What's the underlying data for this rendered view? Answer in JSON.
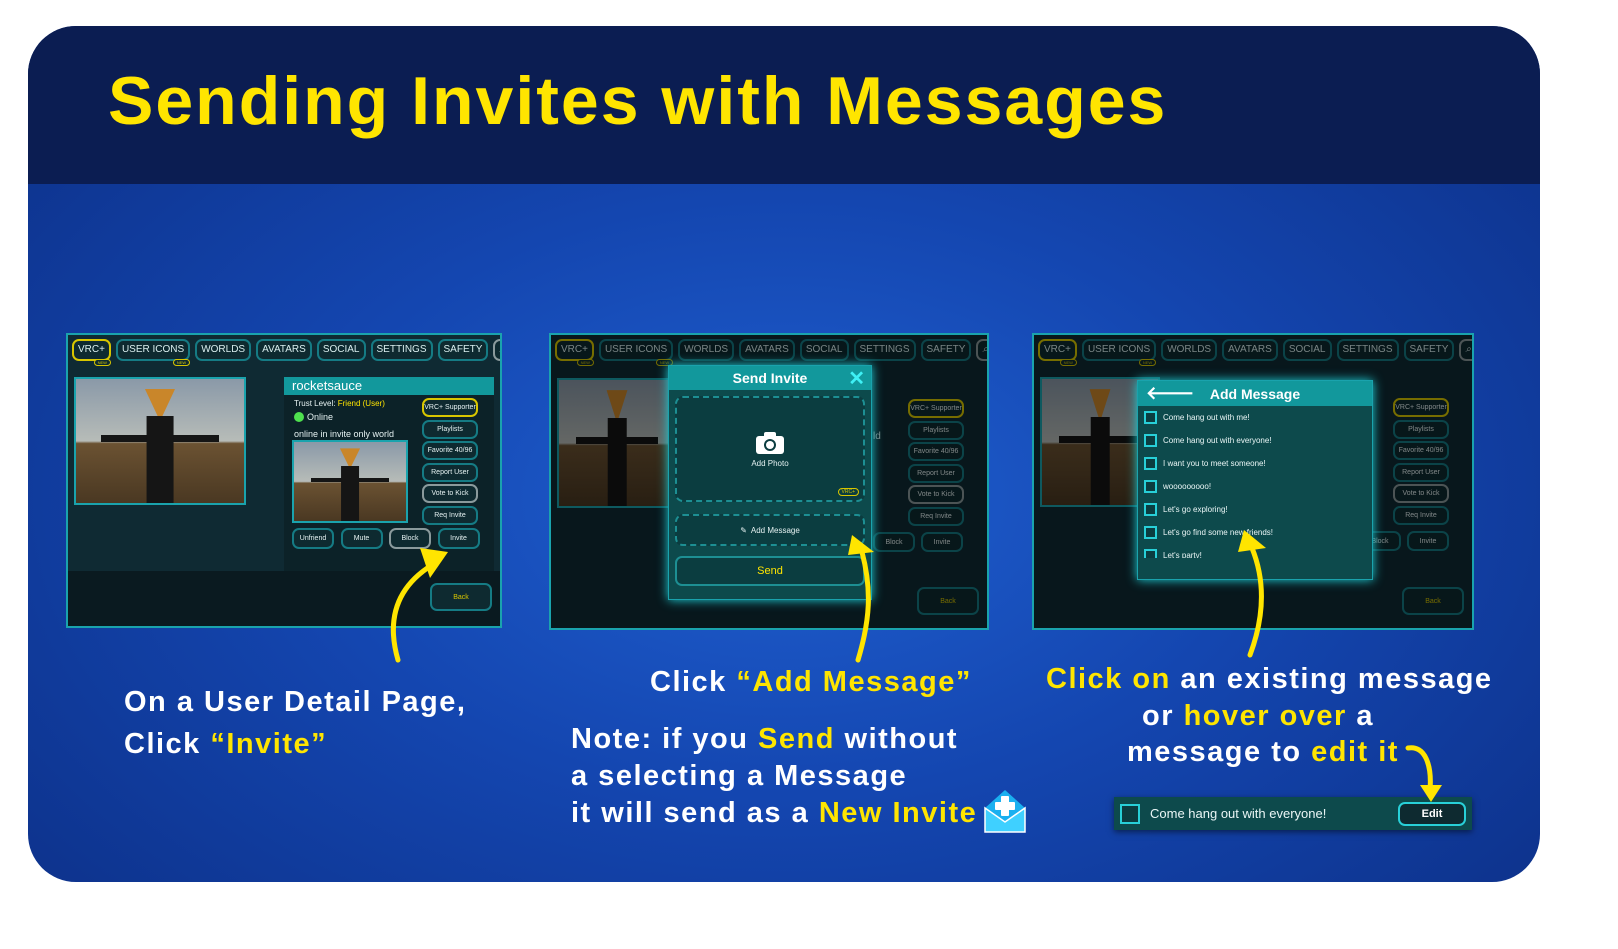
{
  "title": "Sending Invites with Messages",
  "colors": {
    "accent": "#ffe500",
    "teal": "#12989c",
    "background": "#1446b0",
    "header_band": "#0b1d52"
  },
  "nav_tabs": [
    {
      "label": "VRC+",
      "badge": "NEW"
    },
    {
      "label": "USER ICONS",
      "badge": "NEW"
    },
    {
      "label": "WORLDS"
    },
    {
      "label": "AVATARS"
    },
    {
      "label": "SOCIAL"
    },
    {
      "label": "SETTINGS"
    },
    {
      "label": "SAFETY"
    },
    {
      "label": "Search...",
      "icon": "search-icon"
    }
  ],
  "user_detail": {
    "username": "rocketsauce",
    "trust_label": "Trust Level:",
    "trust_value": "Friend (User)",
    "status": "Online",
    "location": "online in invite only world",
    "side_buttons": [
      "VRC+ Supporter",
      "Playlists",
      "Favorite 40/96",
      "Report User",
      "Vote to Kick",
      "Req Invite"
    ],
    "bottom_buttons": [
      "Unfriend",
      "Mute",
      "Block",
      "Invite"
    ],
    "back": "Back",
    "shirt_text": "SUP"
  },
  "send_invite": {
    "title": "Send Invite",
    "add_photo": "Add Photo",
    "vrc_badge": "VRC+",
    "add_message": "Add Message",
    "send": "Send",
    "partial_text": "ld"
  },
  "add_message": {
    "title": "Add Message",
    "messages": [
      "Come hang out with me!",
      "Come hang out with everyone!",
      "I want you to meet someone!",
      "wooooooooo!",
      "Let's go exploring!",
      "Let's go find some new friends!",
      "Let's party!"
    ]
  },
  "edit_bar": {
    "message": "Come hang out with everyone!",
    "edit": "Edit"
  },
  "captions": {
    "step1": {
      "line1": "On a User Detail Page,",
      "line2_a": "Click ",
      "line2_b": "“Invite”"
    },
    "step2": {
      "a": "Click ",
      "b": "“Add Message”"
    },
    "note": {
      "l1_a": "Note: if you ",
      "l1_b": "Send",
      "l1_c": " without",
      "l2": "a selecting a Message",
      "l3_a": "it will send as a ",
      "l3_b": "New Invite"
    },
    "step3": {
      "l1_a": "Click on",
      "l1_b": " an existing message",
      "l2_a": "or ",
      "l2_b": "hover over",
      "l2_c": " a",
      "l3_a": "message to ",
      "l3_b": "edit it"
    }
  }
}
